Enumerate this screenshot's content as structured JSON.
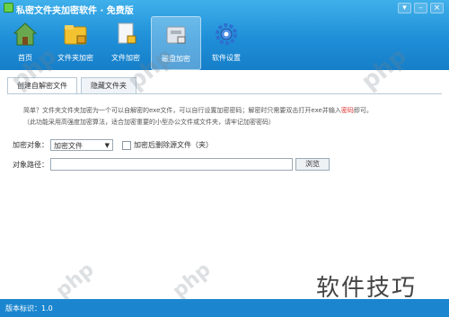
{
  "window": {
    "title": "私密文件夹加密软件 · 免费版",
    "controls": [
      "▾",
      "–",
      "×"
    ]
  },
  "toolbar": {
    "items": [
      {
        "label": "首页",
        "icon": "home-icon",
        "color": "#4a8a2a"
      },
      {
        "label": "文件夹加密",
        "icon": "folder-lock-icon",
        "color": "#f2c230"
      },
      {
        "label": "文件加密",
        "icon": "file-lock-icon",
        "color": "#e9eef2"
      },
      {
        "label": "磁盘加密",
        "icon": "disk-lock-icon",
        "color": "#d6dde3"
      },
      {
        "label": "软件设置",
        "icon": "gear-icon",
        "color": "#2e6fd0"
      }
    ],
    "active_index": 3
  },
  "tabs": [
    {
      "label": "创建自解密文件"
    },
    {
      "label": "隐藏文件夹"
    }
  ],
  "description": {
    "line1_prefix": "简单？文件夹文件夹加密为一个可以自解密的exe文件，可以自行设置加密密码；解密时只需要双击打开exe并输入",
    "line1_highlight": "密码",
    "line1_suffix": "即可。",
    "line2": "（此功能采用高强度加密算法，适合加密重要的小型办公文件或文件夹，请牢记加密密码）"
  },
  "form": {
    "encrypt_object_label": "加密对象：",
    "encrypt_object_value": "加密文件",
    "delete_source_label": "加密后删除源文件（夹）",
    "object_path_label": "对象路径：",
    "object_path_value": "",
    "browse_label": "浏览"
  },
  "status": {
    "text": "版本标识：1.0"
  },
  "watermark": {
    "text": "php",
    "bottom_text": "软件技巧"
  }
}
